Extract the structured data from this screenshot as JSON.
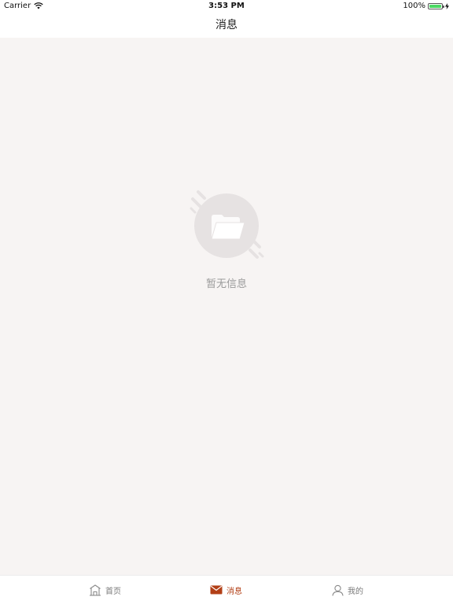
{
  "status_bar": {
    "carrier": "Carrier",
    "time": "3:53 PM",
    "battery": "100%",
    "battery_level": 1.0
  },
  "nav": {
    "title": "消息"
  },
  "empty_state": {
    "icon": "empty-folder-icon",
    "message": "暂无信息"
  },
  "tabs": [
    {
      "label": "首页",
      "icon": "home-icon",
      "active": false
    },
    {
      "label": "消息",
      "icon": "mail-icon",
      "active": true
    },
    {
      "label": "我的",
      "icon": "person-icon",
      "active": false
    }
  ],
  "colors": {
    "accent": "#b23f16",
    "background": "#f7f4f3",
    "inactive_tab": "#7a7a7a",
    "empty_text": "#9a9a9a",
    "battery": "#4cd964"
  }
}
